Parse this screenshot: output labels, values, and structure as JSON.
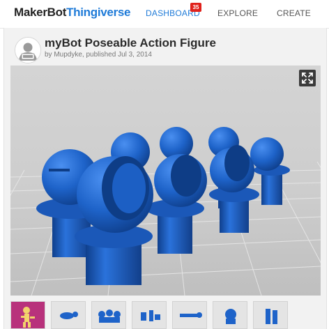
{
  "header": {
    "logo_maker": "MakerBot",
    "logo_thing": "Thingiverse",
    "nav": {
      "dashboard": "DASHBOARD",
      "dashboard_badge": "35",
      "explore": "EXPLORE",
      "create": "CREATE"
    }
  },
  "thing": {
    "title": "myBot Poseable Action Figure",
    "byline": "by Mupdyke, published Jul 3, 2014"
  },
  "viewer": {
    "expand_icon": "expand-icon",
    "thumbnail_count": 7
  },
  "colors": {
    "brand_blue": "#1f7bd8",
    "badge_red": "#e0211b",
    "model_blue": "#1e63c9",
    "viewer_bg": "#cfcfcf"
  }
}
